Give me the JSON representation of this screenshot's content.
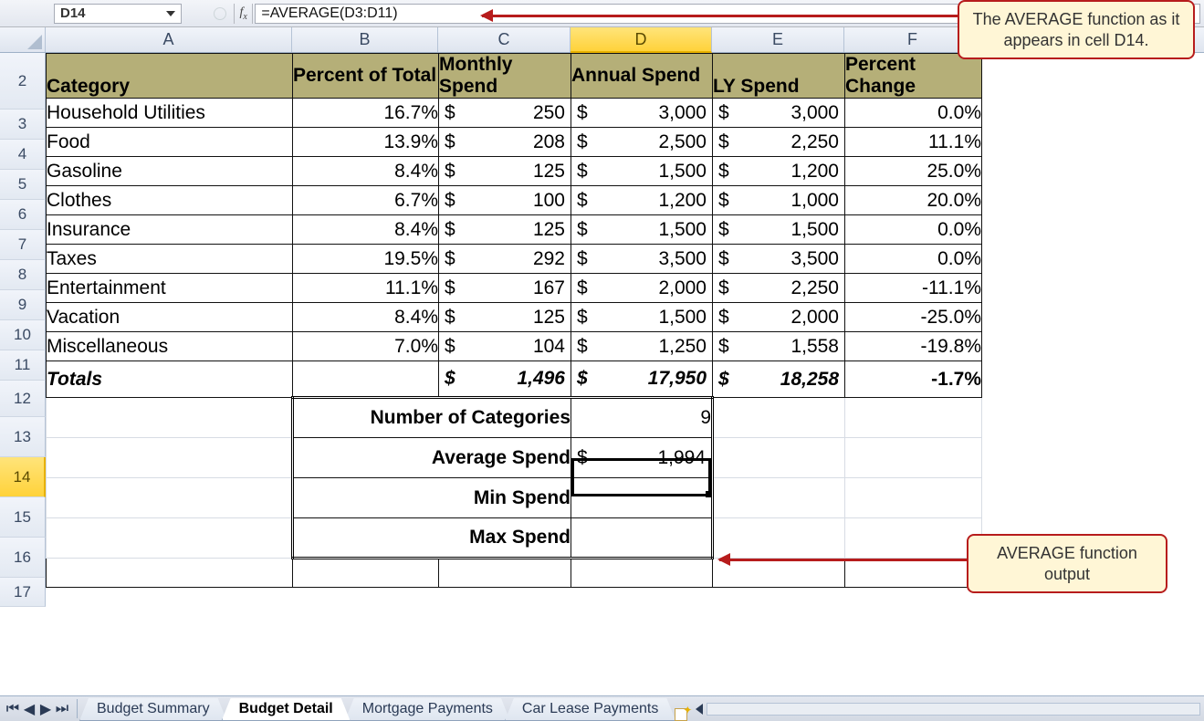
{
  "formula_bar": {
    "name_box": "D14",
    "fx_label": "fx",
    "formula": "=AVERAGE(D3:D11)"
  },
  "columns": [
    "A",
    "B",
    "C",
    "D",
    "E",
    "F"
  ],
  "active_column_index": 3,
  "row_labels": [
    "2",
    "3",
    "4",
    "5",
    "6",
    "7",
    "8",
    "9",
    "10",
    "11",
    "12",
    "13",
    "14",
    "15",
    "16",
    "17"
  ],
  "active_row_label": "14",
  "headers": {
    "A": "Category",
    "B": "Percent of Total",
    "C": "Monthly Spend",
    "D": "Annual Spend",
    "E": "LY Spend",
    "F": "Percent Change"
  },
  "rows": [
    {
      "cat": "Household Utilities",
      "pct": "16.7%",
      "mon": "250",
      "ann": "3,000",
      "ly": "3,000",
      "chg": "0.0%"
    },
    {
      "cat": "Food",
      "pct": "13.9%",
      "mon": "208",
      "ann": "2,500",
      "ly": "2,250",
      "chg": "11.1%"
    },
    {
      "cat": "Gasoline",
      "pct": "8.4%",
      "mon": "125",
      "ann": "1,500",
      "ly": "1,200",
      "chg": "25.0%"
    },
    {
      "cat": "Clothes",
      "pct": "6.7%",
      "mon": "100",
      "ann": "1,200",
      "ly": "1,000",
      "chg": "20.0%"
    },
    {
      "cat": "Insurance",
      "pct": "8.4%",
      "mon": "125",
      "ann": "1,500",
      "ly": "1,500",
      "chg": "0.0%"
    },
    {
      "cat": "Taxes",
      "pct": "19.5%",
      "mon": "292",
      "ann": "3,500",
      "ly": "3,500",
      "chg": "0.0%"
    },
    {
      "cat": "Entertainment",
      "pct": "11.1%",
      "mon": "167",
      "ann": "2,000",
      "ly": "2,250",
      "chg": "-11.1%"
    },
    {
      "cat": "Vacation",
      "pct": "8.4%",
      "mon": "125",
      "ann": "1,500",
      "ly": "2,000",
      "chg": "-25.0%"
    },
    {
      "cat": "Miscellaneous",
      "pct": "7.0%",
      "mon": "104",
      "ann": "1,250",
      "ly": "1,558",
      "chg": "-19.8%"
    }
  ],
  "totals": {
    "label": "Totals",
    "mon": "1,496",
    "ann": "17,950",
    "ly": "18,258",
    "chg": "-1.7%"
  },
  "summary": {
    "num_cat_label": "Number of Categories",
    "num_cat_value": "9",
    "avg_label": "Average Spend",
    "avg_value": "1,994",
    "min_label": "Min Spend",
    "max_label": "Max Spend"
  },
  "currency_symbol": "$",
  "sheet_tabs": {
    "tabs": [
      "Budget Summary",
      "Budget Detail",
      "Mortgage Payments",
      "Car Lease Payments"
    ],
    "active_index": 1
  },
  "callouts": {
    "top": "The AVERAGE function as it appears in cell D14.",
    "bottom": "AVERAGE function output"
  },
  "chart_data": {
    "type": "table",
    "title": "Budget Detail",
    "columns": [
      "Category",
      "Percent of Total",
      "Monthly Spend",
      "Annual Spend",
      "LY Spend",
      "Percent Change"
    ],
    "rows": [
      [
        "Household Utilities",
        0.167,
        250,
        3000,
        3000,
        0.0
      ],
      [
        "Food",
        0.139,
        208,
        2500,
        2250,
        0.111
      ],
      [
        "Gasoline",
        0.084,
        125,
        1500,
        1200,
        0.25
      ],
      [
        "Clothes",
        0.067,
        100,
        1200,
        1000,
        0.2
      ],
      [
        "Insurance",
        0.084,
        125,
        1500,
        1500,
        0.0
      ],
      [
        "Taxes",
        0.195,
        292,
        3500,
        3500,
        0.0
      ],
      [
        "Entertainment",
        0.111,
        167,
        2000,
        2250,
        -0.111
      ],
      [
        "Vacation",
        0.084,
        125,
        1500,
        2000,
        -0.25
      ],
      [
        "Miscellaneous",
        0.07,
        104,
        1250,
        1558,
        -0.198
      ]
    ],
    "totals": {
      "Monthly Spend": 1496,
      "Annual Spend": 17950,
      "LY Spend": 18258,
      "Percent Change": -0.017
    },
    "summary": {
      "Number of Categories": 9,
      "Average Spend": 1994
    }
  }
}
